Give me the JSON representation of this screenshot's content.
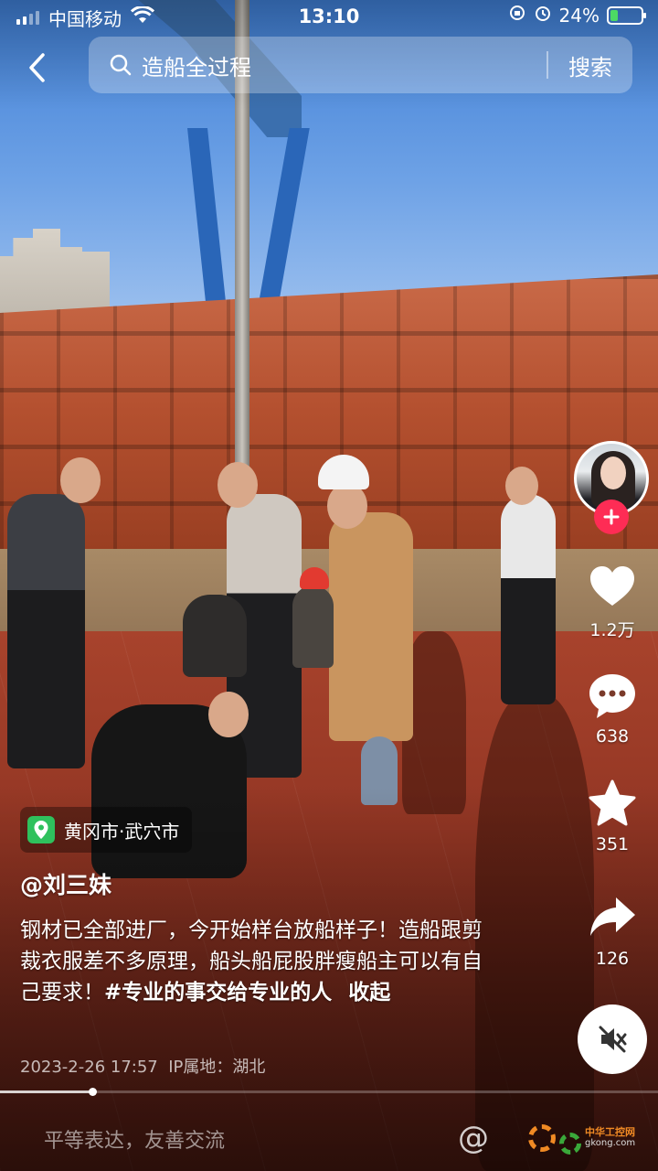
{
  "status_bar": {
    "carrier": "中国移动",
    "time": "13:10",
    "battery_percent": "24%",
    "battery_level": 0.24,
    "icons": [
      "signal-icon",
      "wifi-icon",
      "orientation-lock-icon",
      "alarm-icon",
      "battery-charging-icon"
    ]
  },
  "search": {
    "query": "造船全过程",
    "button_label": "搜索"
  },
  "actions": {
    "like_count": "1.2万",
    "comment_count": "638",
    "favorite_count": "351",
    "share_count": "126"
  },
  "video": {
    "location": "黄冈市·武穴市",
    "author": "@刘三妹",
    "caption_text": "钢材已全部进厂，今开始样台放船样子！造船跟剪裁衣服差不多原理，船头船屁股胖瘦船主可以有自己要求！",
    "hashtag": "#专业的事交给专业的人",
    "collapse_label": "收起",
    "timestamp": "2023-2-26 17:57",
    "ip_location": "IP属地：湖北",
    "progress": 0.14
  },
  "comment_bar": {
    "placeholder": "平等表达，友善交流",
    "at_symbol": "@"
  },
  "watermark": {
    "cn": "中华工控网",
    "en": "gkong.com"
  },
  "colors": {
    "follow_button": "#fe2c55",
    "location_icon_bg": "#2fc15d",
    "battery_fill": "#4cd964"
  }
}
